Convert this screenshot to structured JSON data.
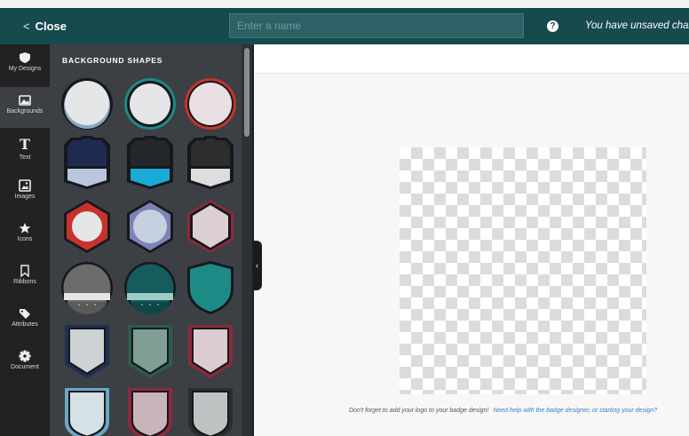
{
  "header": {
    "close_label": "Close",
    "name_placeholder": "Enter a name",
    "name_value": "",
    "help_glyph": "?",
    "unsaved_text": "You have unsaved changes"
  },
  "sidebar": {
    "items": [
      {
        "label": "My Designs",
        "icon": "shield-icon"
      },
      {
        "label": "Backgrounds",
        "icon": "image-icon"
      },
      {
        "label": "Text",
        "icon": "text-icon"
      },
      {
        "label": "Images",
        "icon": "picture-icon"
      },
      {
        "label": "Icons",
        "icon": "star-icon"
      },
      {
        "label": "Ribbons",
        "icon": "bookmark-icon"
      },
      {
        "label": "Attributes",
        "icon": "tag-icon"
      },
      {
        "label": "Document",
        "icon": "gear-icon"
      }
    ],
    "active": "Backgrounds"
  },
  "panel": {
    "title": "BACKGROUND SHAPES",
    "text_glyph": "T",
    "collapse_glyph": "‹"
  },
  "shape_colors": {
    "row1": [
      "#e5e6e8",
      "#1d8a85",
      "#c8322d"
    ],
    "row2": [
      "#1f2a52",
      "#1aaad6",
      "#2d2d2d"
    ],
    "row3": [
      "#c8322d",
      "#7e83b4",
      "#8b2a3d"
    ],
    "row4": [
      "#6c6c6c",
      "#155c5e",
      "#1d8a85"
    ],
    "row5": [
      "#1f3150",
      "#2d5c4a",
      "#8b2a3d"
    ],
    "row6": [
      "#6aa8c4",
      "#8b2a3d",
      "#2d2d2d"
    ]
  },
  "footer": {
    "note": "Don't forget to add your logo to your badge design!",
    "help_link": "Need help with the badge designer, or starting your design?"
  }
}
